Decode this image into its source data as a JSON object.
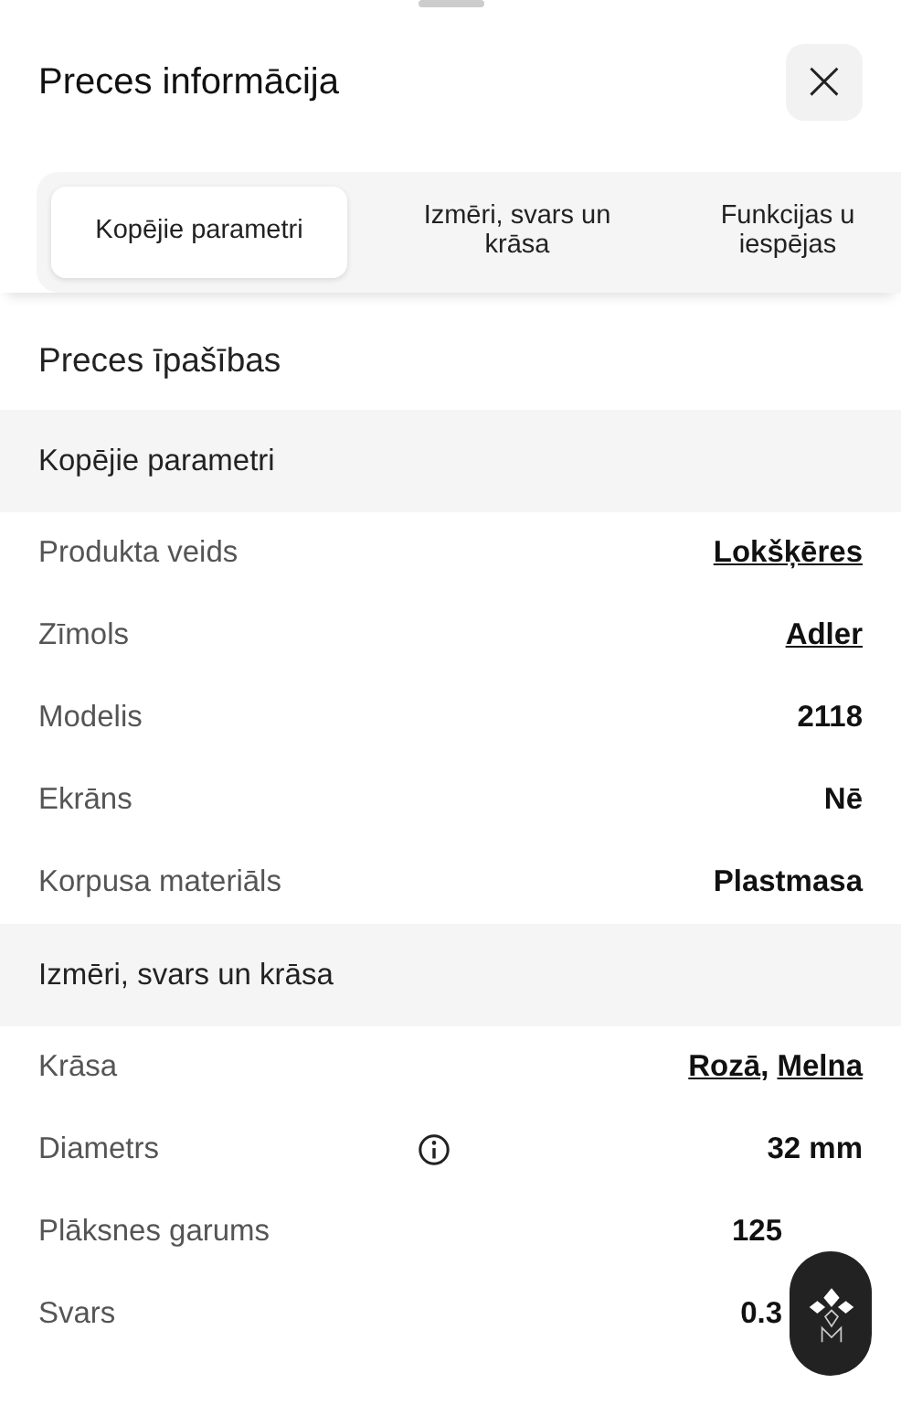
{
  "header": {
    "title": "Preces informācija",
    "close": "×"
  },
  "tabs": [
    {
      "label": "Kopējie parametri",
      "selected": true
    },
    {
      "label": "Izmēri, svars un krāsa",
      "selected": false
    },
    {
      "label": "Funkcijas u iespējas",
      "selected": false
    }
  ],
  "heading": "Preces īpašības",
  "sections": [
    {
      "title": "Kopējie parametri",
      "rows": [
        {
          "label": "Produkta veids",
          "info": false,
          "value": [
            {
              "text": "Lokšķēres",
              "link": true
            }
          ]
        },
        {
          "label": "Zīmols",
          "info": false,
          "value": [
            {
              "text": "Adler",
              "link": true
            }
          ]
        },
        {
          "label": "Modelis",
          "info": false,
          "value": [
            {
              "text": "2118",
              "link": false
            }
          ]
        },
        {
          "label": "Ekrāns",
          "info": false,
          "value": [
            {
              "text": "Nē",
              "link": false
            }
          ]
        },
        {
          "label": "Korpusa materiāls",
          "info": false,
          "value": [
            {
              "text": "Plastmasa",
              "link": false
            }
          ]
        }
      ]
    },
    {
      "title": "Izmēri, svars un krāsa",
      "rows": [
        {
          "label": "Krāsa",
          "info": false,
          "value": [
            {
              "text": "Rozā",
              "link": true
            },
            {
              "text": ", ",
              "link": false
            },
            {
              "text": "Melna",
              "link": true
            }
          ]
        },
        {
          "label": "Diametrs",
          "info": true,
          "value": [
            {
              "text": "32 mm",
              "link": false
            }
          ]
        },
        {
          "label": "Plāksnes garums",
          "info": false,
          "value": [
            {
              "text": "125",
              "link": false
            }
          ]
        },
        {
          "label": "Svars",
          "info": false,
          "value": [
            {
              "text": "0.3",
              "link": false
            }
          ]
        }
      ]
    }
  ]
}
